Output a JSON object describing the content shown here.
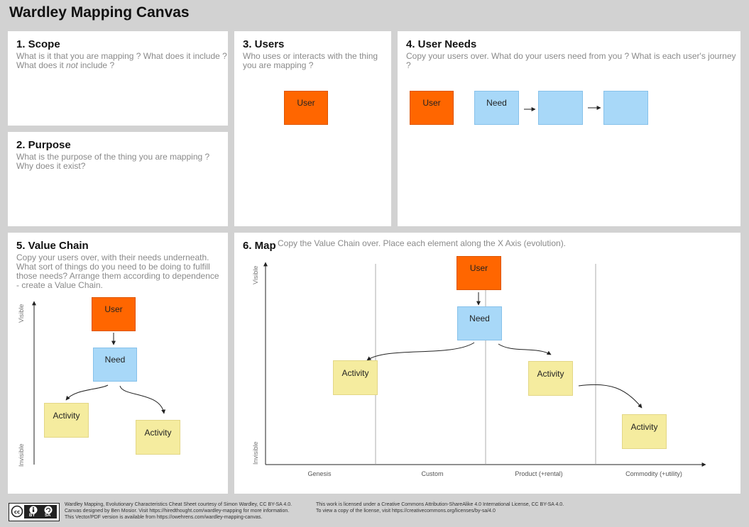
{
  "title": "Wardley Mapping Canvas",
  "scope": {
    "title": "1. Scope",
    "desc": "What is it that you are mapping ? What does it include ?\nWhat does it",
    "desc_em": "not",
    "desc_end": "include ?"
  },
  "purpose": {
    "title": "2. Purpose",
    "desc": "What is the purpose of the thing you are mapping ?\nWhy does it exist?"
  },
  "users": {
    "title": "3. Users",
    "desc": "Who uses or interacts with the thing\nyou are mapping ?",
    "user_label": "User"
  },
  "user_needs": {
    "title": "4. User Needs",
    "desc": "Copy your users over. What do your users need from you ? What is each user's journey ?",
    "user_label": "User",
    "need_label": "Need"
  },
  "value_chain": {
    "title": "5. Value Chain",
    "desc": "Copy your users over, with their needs underneath.\nWhat sort of things do you need to be doing to fulfill\nthose needs? Arrange them according to dependence\n- create a Value Chain.",
    "y_top": "Visible",
    "y_bottom": "Invisible",
    "user_label": "User",
    "need_label": "Need",
    "activity1": "Activity",
    "activity2": "Activity"
  },
  "map": {
    "title": "6. Map",
    "desc": "Copy the Value Chain over. Place each element along the X Axis (evolution).",
    "y_top": "Visible",
    "y_bottom": "Invisible",
    "stages": [
      "Genesis",
      "Custom",
      "Product (+rental)",
      "Commodity (+utility)"
    ],
    "user_label": "User",
    "need_label": "Need",
    "activity1": "Activity",
    "activity2": "Activity",
    "activity3": "Activity"
  },
  "footer": {
    "cc_by": "BY",
    "cc_sa": "SA",
    "left": [
      "Wardley Mapping, Evolutionary Characteristics Cheat Sheet courtesy of Simon Wardley, CC BY-SA 4.0.",
      "Canvas designed by Ben Mosior. Visit https://hiredthought.com/wardley-mapping for more information.",
      "This Vector/PDF version is available from https://owehrens.com/wardley-mapping-canvas."
    ],
    "right": [
      "This work is licensed under a Creative Commons Attribution-ShareAlike 4.0 International License, CC BY-SA 4.0.",
      "To view a copy of the license, visit https://creativecommons.org/licenses/by-sa/4.0"
    ]
  }
}
